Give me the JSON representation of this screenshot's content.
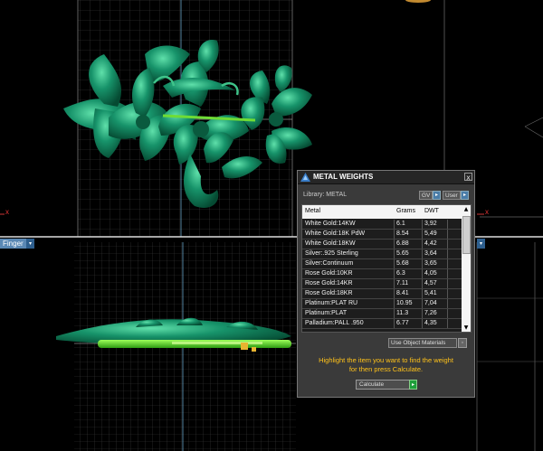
{
  "viewports": {
    "bottom_left_label": "Finger",
    "arrow": "▾"
  },
  "axis_marks": {
    "x_left": "x",
    "x_right": "x"
  },
  "colors": {
    "background": "#000000",
    "grid": "#5a5a5a",
    "model": "#0e7a55",
    "model_highlight": "#4fd39a",
    "ring": "#5cd52e",
    "panel": "#3a3a3a",
    "instruction": "#ffc21a"
  },
  "panel": {
    "title": "METAL WEIGHTS",
    "close": "x",
    "library_label": "Library: METAL",
    "toggle_gv": "GV",
    "toggle_user": "User",
    "toggle_btn": "▸",
    "columns": [
      "Metal",
      "Grams",
      "DWT"
    ],
    "rows": [
      [
        "White Gold:14KW",
        "6.1",
        "3,92"
      ],
      [
        "White Gold:18K PdW",
        "8.54",
        "5,49"
      ],
      [
        "White Gold:18KW",
        "6.88",
        "4,42"
      ],
      [
        "Silver:.925 Sterling",
        "5.65",
        "3,64"
      ],
      [
        "Silver:Continuum",
        "5.68",
        "3,65"
      ],
      [
        "Rose Gold:10KR",
        "6.3",
        "4,05"
      ],
      [
        "Rose Gold:14KR",
        "7.11",
        "4,57"
      ],
      [
        "Rose Gold:18KR",
        "8.41",
        "5,41"
      ],
      [
        "Platinum:PLAT RU",
        "10.95",
        "7,04"
      ],
      [
        "Platinum:PLAT",
        "11.3",
        "7,26"
      ],
      [
        "Palladium:PALL .950",
        "6.77",
        "4,35"
      ]
    ],
    "scroll_up": "▲",
    "scroll_down": "▼",
    "use_object_materials": "Use Object Materials",
    "use_object_btn": "◦",
    "instruction_line1": "Highlight the item you want to find the weight",
    "instruction_line2": "for then press Calculate.",
    "calculate_label": "Calculate",
    "calculate_go": "▸"
  },
  "icons": {
    "logo": "pyramid-logo-icon",
    "close": "close-icon",
    "calculate": "play-icon"
  }
}
